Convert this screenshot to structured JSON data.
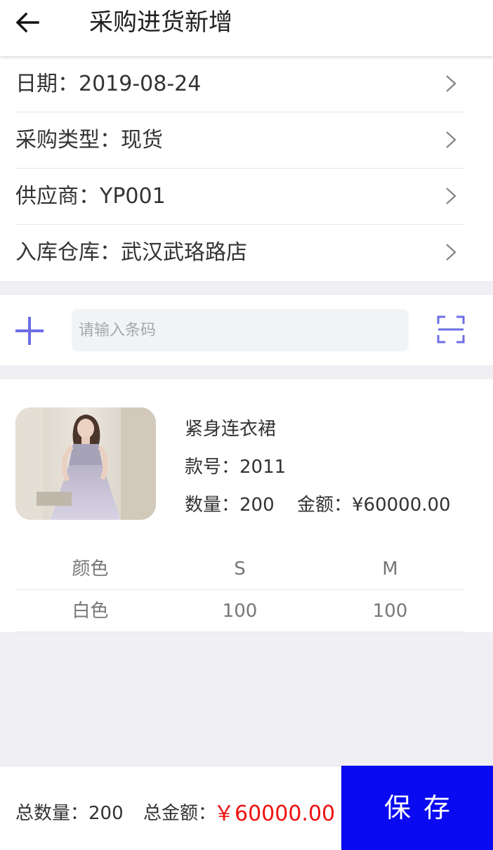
{
  "header": {
    "title": "采购进货新增",
    "back_icon": "arrow-left-icon"
  },
  "info": {
    "rows": [
      {
        "label": "日期",
        "value": "2019-08-24",
        "display": "日期：2019-08-24"
      },
      {
        "label": "采购类型",
        "value": "现货",
        "display": "采购类型：现货"
      },
      {
        "label": "供应商",
        "value": "YP001",
        "display": "供应商：YP001"
      },
      {
        "label": "入库仓库",
        "value": "武汉武珞路店",
        "display": "入库仓库：武汉武珞路店"
      }
    ],
    "chevron_icon": "chevron-right-icon"
  },
  "scan": {
    "placeholder": "请输入条码",
    "plus_icon": "plus-icon",
    "scan_icon": "scan-icon",
    "accent": "#6d6de6"
  },
  "product": {
    "name": "紧身连衣裙",
    "sku_display": "款号：2011",
    "qty_display": "数量：200",
    "amount_display": "金额：¥60000.00",
    "size_table": {
      "headers": [
        "颜色",
        "S",
        "M"
      ],
      "rows": [
        [
          "白色",
          "100",
          "100"
        ]
      ]
    }
  },
  "footer": {
    "total_qty_display": "总数量：200",
    "total_amount_label": "总金额：",
    "total_amount_value": "￥60000.00",
    "save_label": "保存",
    "accent_red": "#ee1111",
    "save_bg": "#0a0af0"
  }
}
